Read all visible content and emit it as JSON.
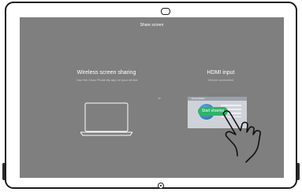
{
  "screen": {
    "title": "Share screen",
    "background_color": "#7f7f7f"
  },
  "wireless": {
    "title": "Wireless screen sharing",
    "subtitle": "Use the Cisco Proximity app on your device"
  },
  "divider_label": "or",
  "hdmi": {
    "title": "HDMI input",
    "subtitle": "Device connected",
    "preview_header": "Presentation",
    "start_button_label": "Start sharing",
    "start_button_color": "#2fb36b"
  },
  "device": {
    "camera_icon": "camera-icon",
    "home_button_icon": "home-button-icon"
  },
  "gesture": {
    "icon": "tap-hand-icon"
  }
}
